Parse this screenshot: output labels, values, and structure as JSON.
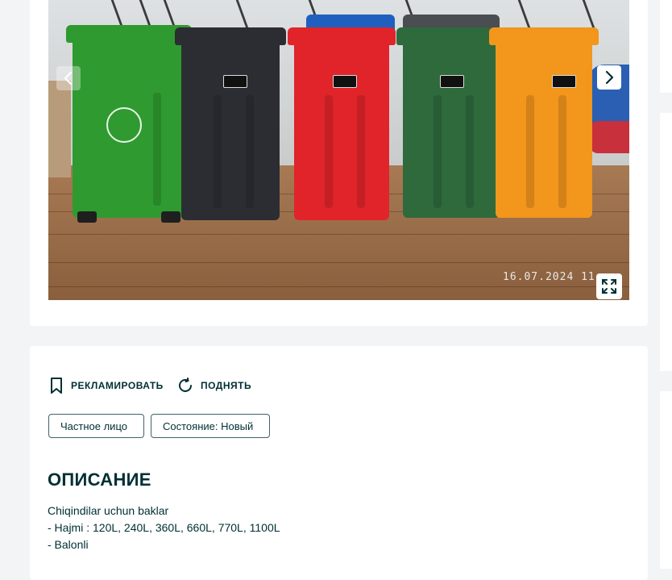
{
  "gallery": {
    "photo_date": "16.07.2024 11:",
    "icons": {
      "prev": "chevron-left-icon",
      "next": "chevron-right-icon",
      "expand": "expand-icon"
    },
    "bin_colors": [
      "#2f9a2f",
      "#2b2d33",
      "#e0242a",
      "#2e6a3c",
      "#f2961c"
    ]
  },
  "actions": {
    "promote_label": "РЕКЛАМИРОВАТЬ",
    "raise_label": "ПОДНЯТЬ",
    "promote_icon": "bookmark-icon",
    "raise_icon": "refresh-icon"
  },
  "tags": {
    "seller_type": "Частное лицо",
    "condition": "Состояние: Новый"
  },
  "description": {
    "title": "ОПИСАНИЕ",
    "lines": [
      "Chiqindilar uchun baklar",
      "- Hajmi : 120L, 240L, 360L, 660L, 770L, 1100L",
      "- Balonli"
    ]
  },
  "colors": {
    "text": "#002f34",
    "background": "#f2f4f5",
    "card": "#ffffff"
  }
}
